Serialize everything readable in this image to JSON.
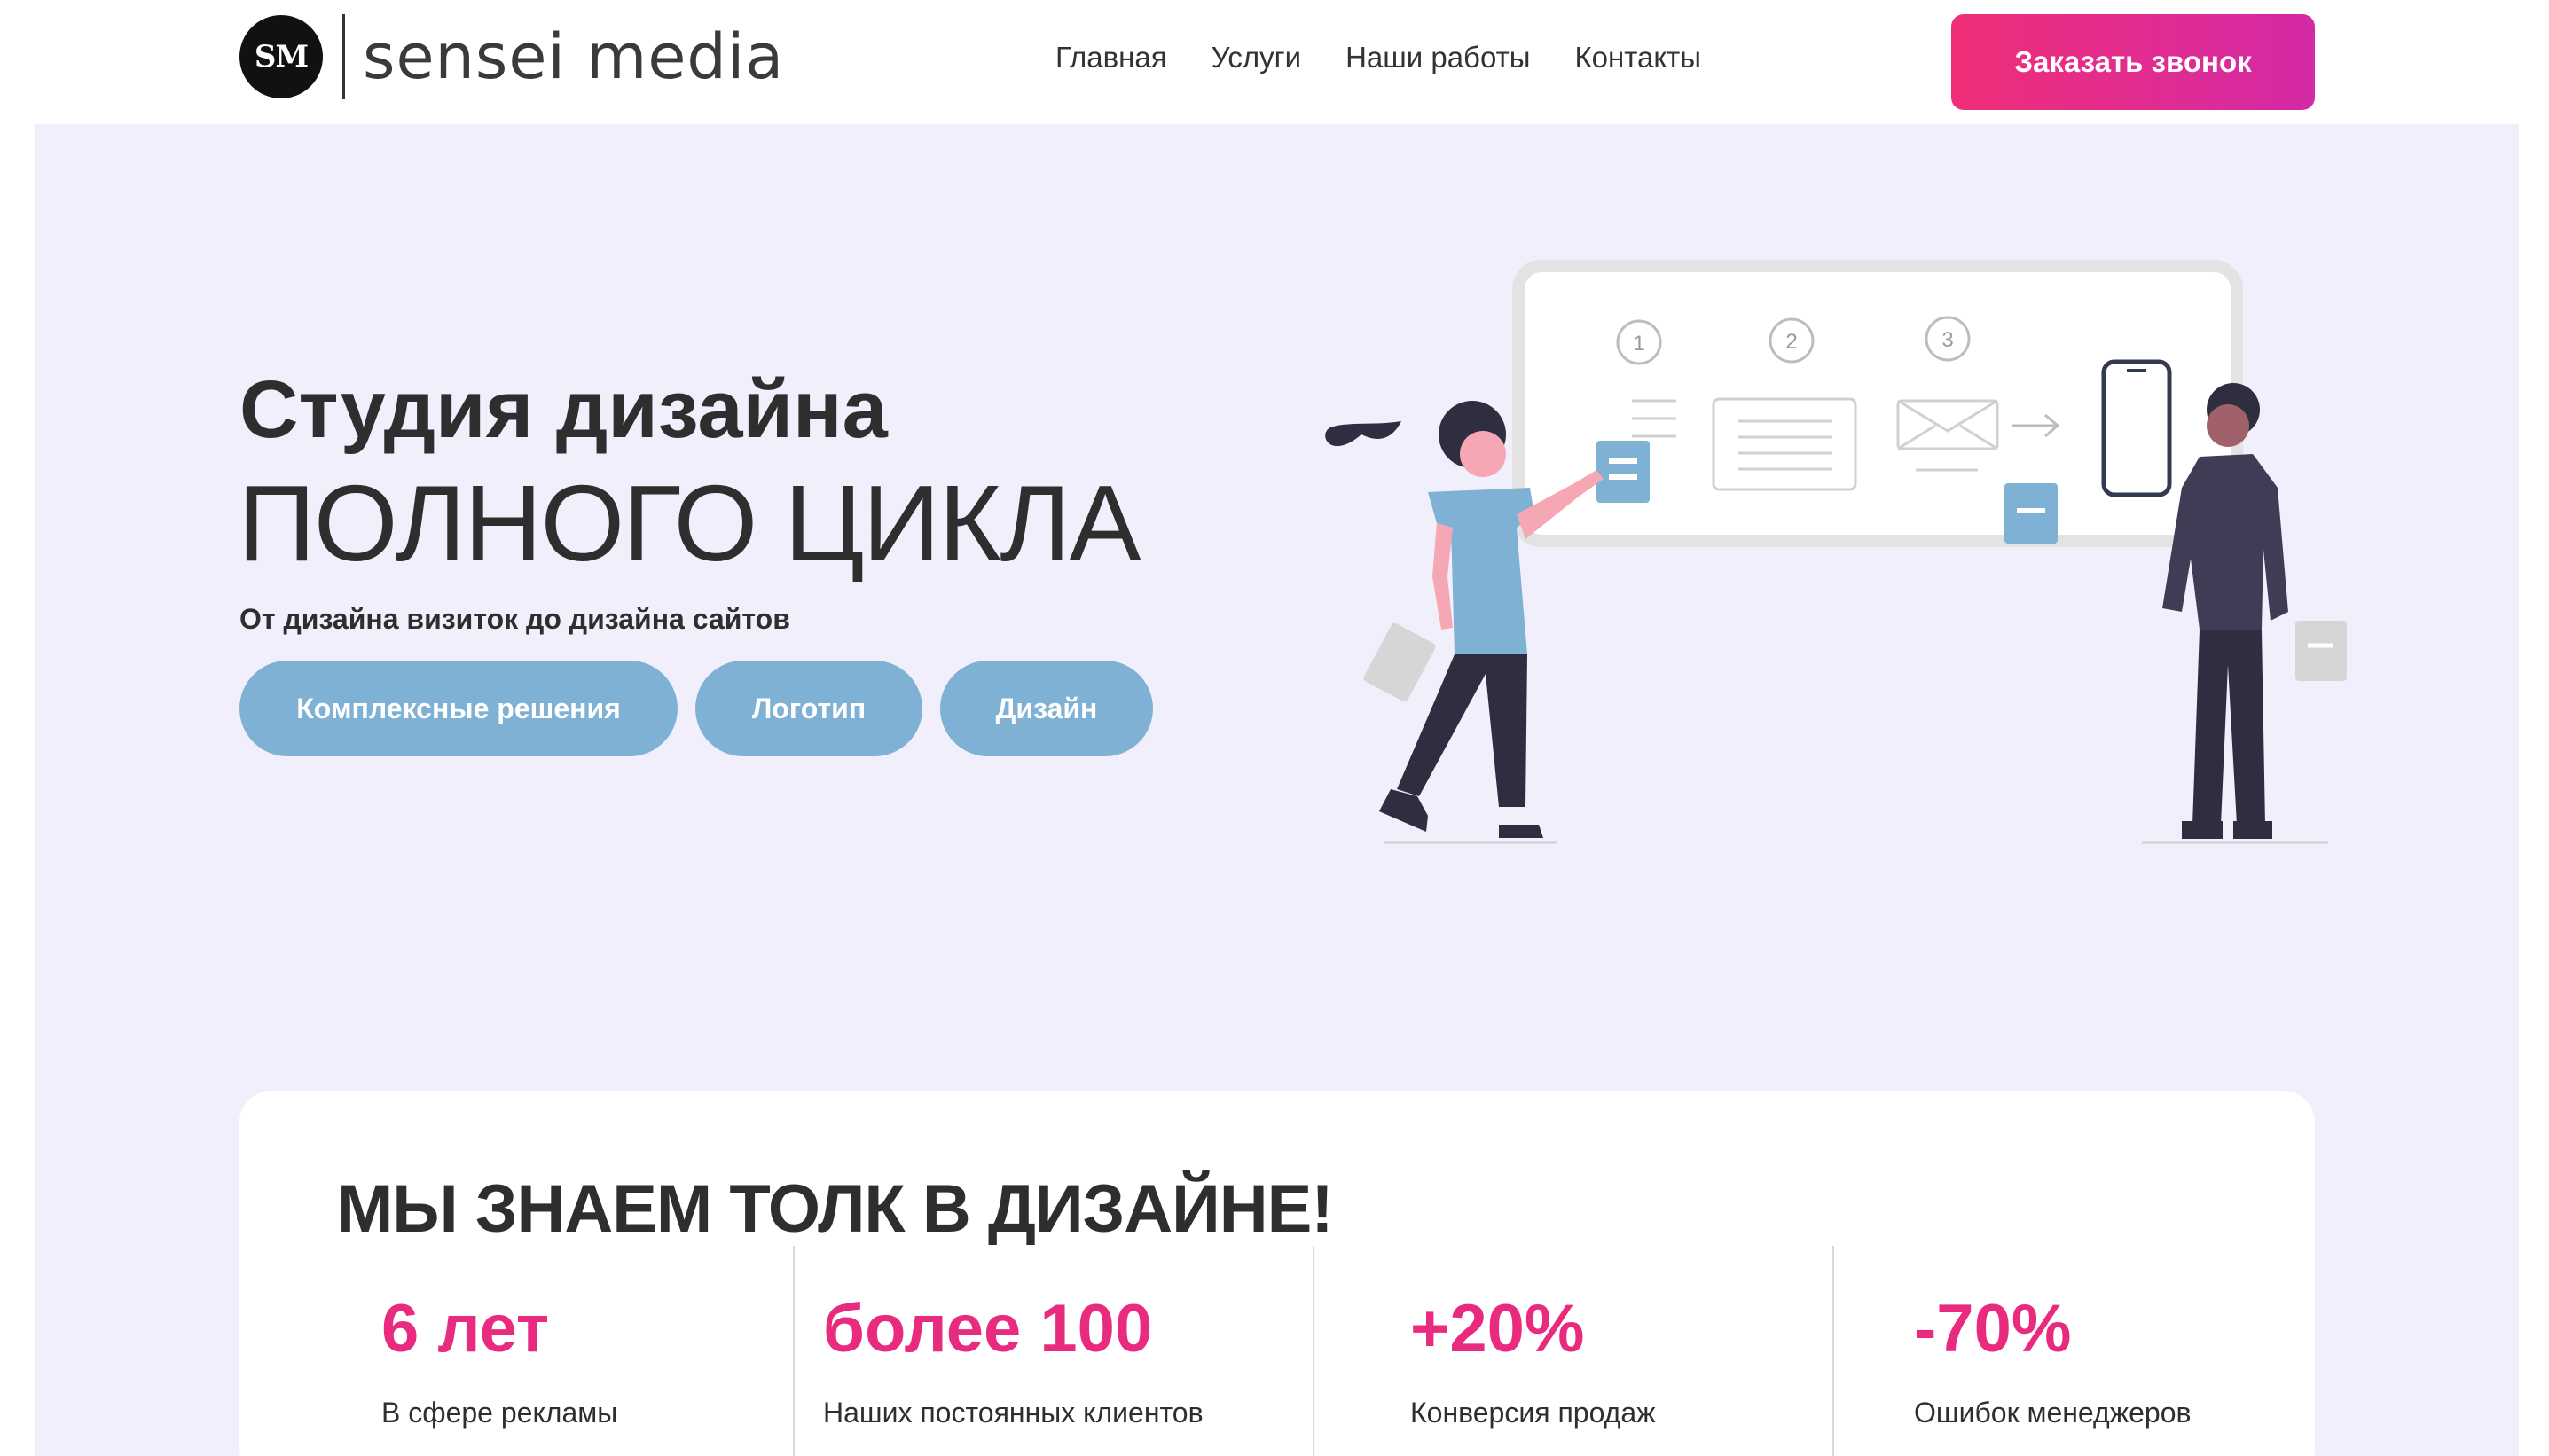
{
  "brand": {
    "logo_initials": "SM",
    "name": "sensei media"
  },
  "nav": {
    "items": [
      "Главная",
      "Услуги",
      "Наши работы",
      "Контакты"
    ]
  },
  "header": {
    "cta_label": "Заказать звонок"
  },
  "hero": {
    "title_line1": "Студия дизайна",
    "title_line2": "ПОЛНОГО ЦИКЛА",
    "subtitle": "От дизайна визиток до дизайна сайтов",
    "pills": [
      "Комплексные решения",
      "Логотип",
      "Дизайн"
    ],
    "steps": [
      "1",
      "2",
      "3"
    ]
  },
  "stats": {
    "title": "МЫ ЗНАЕМ ТОЛК В ДИЗАЙНЕ!",
    "items": [
      {
        "value": "6 лет",
        "label": "В сфере рекламы"
      },
      {
        "value": "более 100",
        "label": "Наших постоянных клиентов"
      },
      {
        "value": "+20%",
        "label": "Конверсия продаж"
      },
      {
        "value": "-70%",
        "label": "Ошибок менеджеров"
      }
    ]
  },
  "colors": {
    "accent": "#e82b7e",
    "pill": "#7fb1d4",
    "background": "#f2effc"
  }
}
